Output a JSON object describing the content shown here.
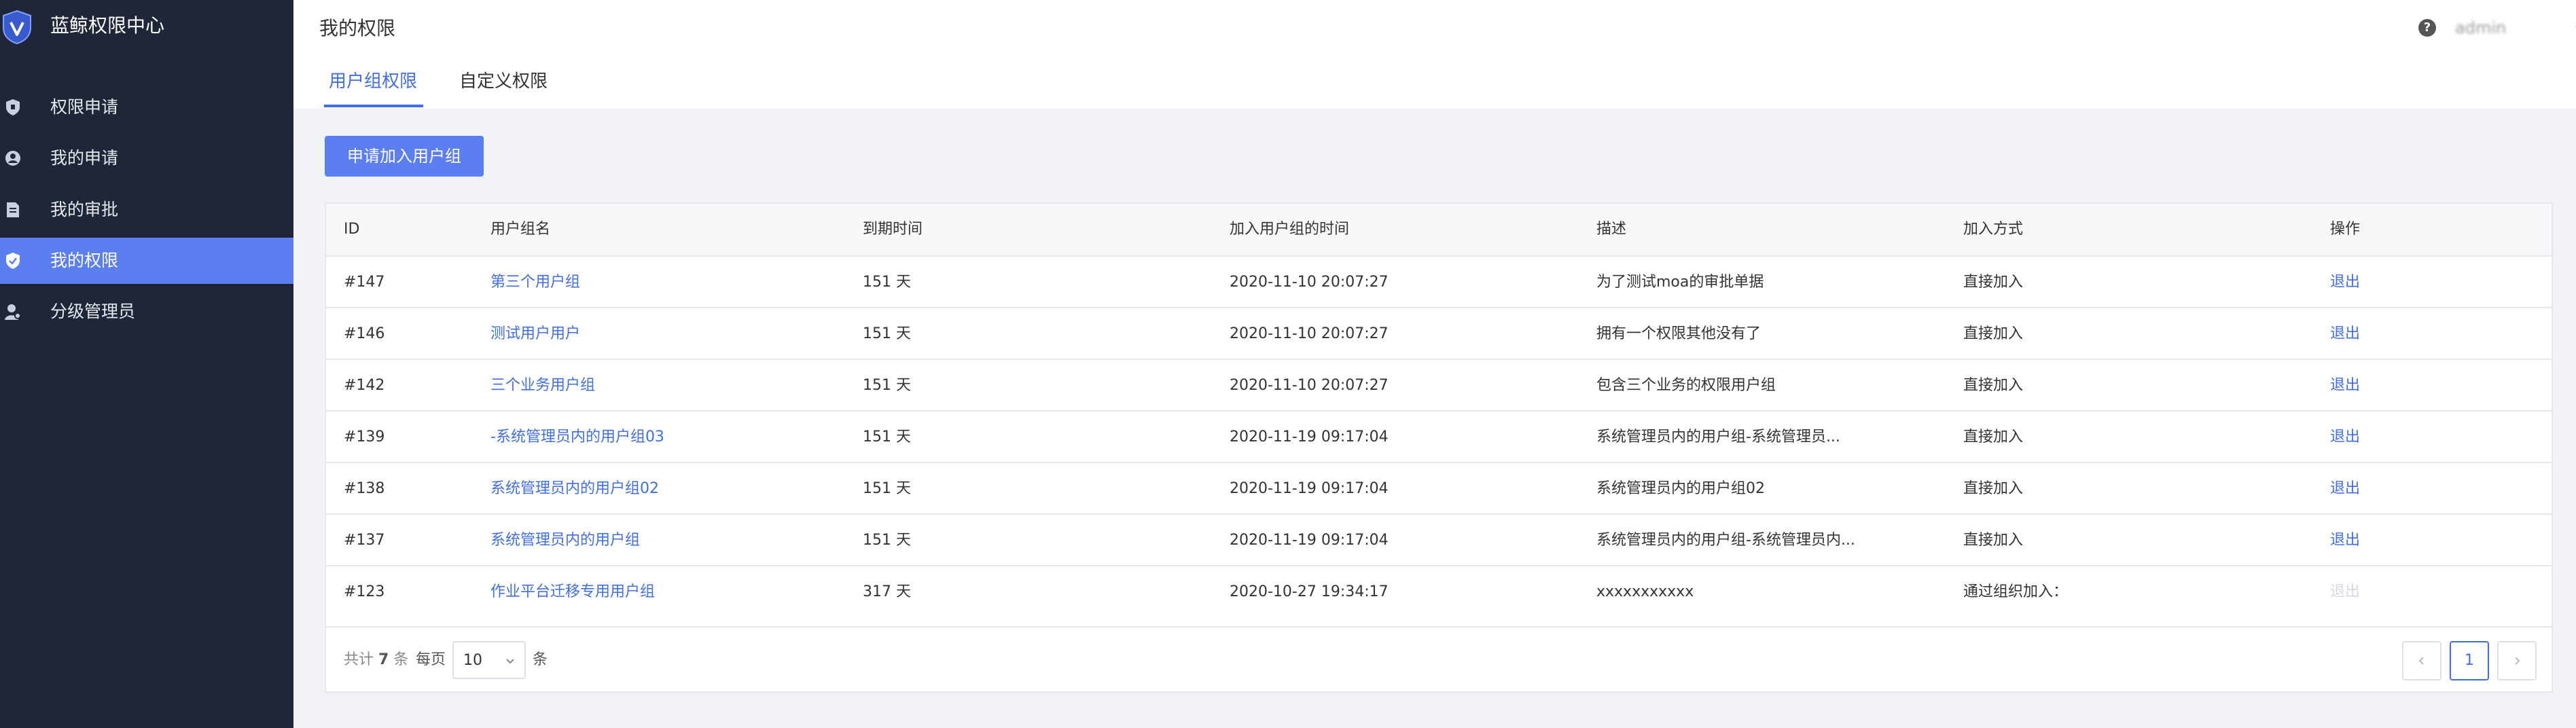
{
  "app": {
    "title": "蓝鲸权限中心"
  },
  "sidebar": {
    "items": [
      {
        "label": "权限申请",
        "icon": "shield-icon",
        "active": false
      },
      {
        "label": "我的申请",
        "icon": "user-circle-icon",
        "active": false
      },
      {
        "label": "我的审批",
        "icon": "document-icon",
        "active": false
      },
      {
        "label": "我的权限",
        "icon": "shield-check-icon",
        "active": true
      },
      {
        "label": "分级管理员",
        "icon": "user-admin-icon",
        "active": false
      }
    ]
  },
  "header": {
    "title": "我的权限",
    "tabs": [
      {
        "label": "用户组权限",
        "active": true
      },
      {
        "label": "自定义权限",
        "active": false
      }
    ],
    "user": {
      "name": "admin",
      "help_icon": "help-icon",
      "dropdown_icon": "chevron-down-icon"
    }
  },
  "actions": {
    "apply_label": "申请加入用户组"
  },
  "table": {
    "columns": [
      "ID",
      "用户组名",
      "到期时间",
      "加入用户组的时间",
      "描述",
      "加入方式",
      "操作"
    ],
    "rows": [
      {
        "id": "#147",
        "name": "第三个用户组",
        "expire": "151 天",
        "joined": "2020-11-10 20:07:27",
        "desc": "为了测试moa的审批单据",
        "method": "直接加入",
        "action": "退出",
        "action_enabled": true
      },
      {
        "id": "#146",
        "name": "测试用户用户",
        "expire": "151 天",
        "joined": "2020-11-10 20:07:27",
        "desc": "拥有一个权限其他没有了",
        "method": "直接加入",
        "action": "退出",
        "action_enabled": true
      },
      {
        "id": "#142",
        "name": "三个业务用户组",
        "expire": "151 天",
        "joined": "2020-11-10 20:07:27",
        "desc": "包含三个业务的权限用户组",
        "method": "直接加入",
        "action": "退出",
        "action_enabled": true
      },
      {
        "id": "#139",
        "name": "-系统管理员内的用户组03",
        "expire": "151 天",
        "joined": "2020-11-19 09:17:04",
        "desc": "系统管理员内的用户组-系统管理员...",
        "method": "直接加入",
        "action": "退出",
        "action_enabled": true
      },
      {
        "id": "#138",
        "name": "系统管理员内的用户组02",
        "expire": "151 天",
        "joined": "2020-11-19 09:17:04",
        "desc": "系统管理员内的用户组02",
        "method": "直接加入",
        "action": "退出",
        "action_enabled": true
      },
      {
        "id": "#137",
        "name": "系统管理员内的用户组",
        "expire": "151 天",
        "joined": "2020-11-19 09:17:04",
        "desc": "系统管理员内的用户组-系统管理员内...",
        "method": "直接加入",
        "action": "退出",
        "action_enabled": true
      },
      {
        "id": "#123",
        "name": "作业平台迁移专用用户组",
        "expire": "317 天",
        "joined": "2020-10-27 19:34:17",
        "desc": "xxxxxxxxxxx",
        "method": "通过组织加入：",
        "action": "退出",
        "action_enabled": false
      }
    ]
  },
  "pagination": {
    "total_prefix": "共计",
    "total": "7",
    "total_suffix": "条",
    "per_page_label": "每页",
    "page_size": "10",
    "per_page_unit": "条",
    "current_page": "1",
    "prev_icon": "chevron-left-icon",
    "next_icon": "chevron-right-icon"
  },
  "colors": {
    "accent": "#3e6ee8",
    "sidebar_bg": "#1f2638",
    "active_item": "#5b7ff1"
  }
}
